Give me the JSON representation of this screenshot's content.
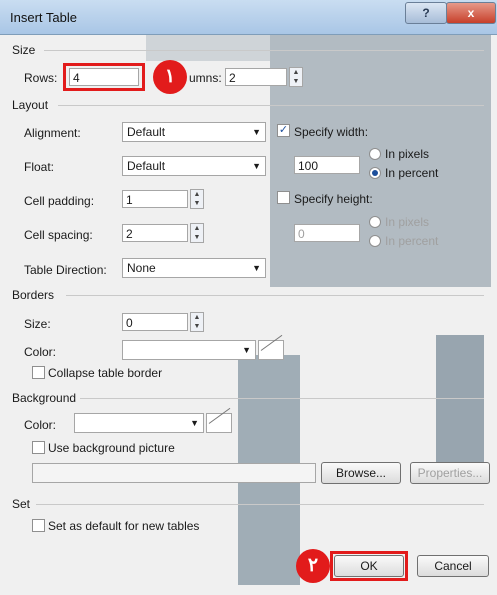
{
  "window": {
    "title": "Insert Table",
    "help_label": "?",
    "close_label": "x"
  },
  "size": {
    "group": "Size",
    "rows_label": "Rows:",
    "rows_value": "4",
    "columns_label": "umns:",
    "columns_value": "2"
  },
  "layout": {
    "group": "Layout",
    "alignment_label": "Alignment:",
    "alignment_value": "Default",
    "float_label": "Float:",
    "float_value": "Default",
    "cell_padding_label": "Cell padding:",
    "cell_padding_value": "1",
    "cell_spacing_label": "Cell spacing:",
    "cell_spacing_value": "2",
    "table_direction_label": "Table Direction:",
    "table_direction_value": "None",
    "specify_width_label": "Specify width:",
    "width_value": "100",
    "in_pixels_label": "In pixels",
    "in_percent_label": "In percent",
    "specify_height_label": "Specify height:",
    "height_value": "0",
    "height_in_pixels_label": "In pixels",
    "height_in_percent_label": "In percent"
  },
  "borders": {
    "group": "Borders",
    "size_label": "Size:",
    "size_value": "0",
    "color_label": "Color:",
    "collapse_label": "Collapse table border"
  },
  "background": {
    "group": "Background",
    "color_label": "Color:",
    "use_picture_label": "Use background picture",
    "browse_label": "Browse...",
    "properties_label": "Properties..."
  },
  "set": {
    "group": "Set",
    "default_label": "Set as default for new tables"
  },
  "buttons": {
    "ok_label": "OK",
    "cancel_label": "Cancel"
  },
  "callouts": {
    "one": "١",
    "two": "٢"
  },
  "colors": {
    "accent": "#e21b1b",
    "checked": "#1d4f9c"
  }
}
